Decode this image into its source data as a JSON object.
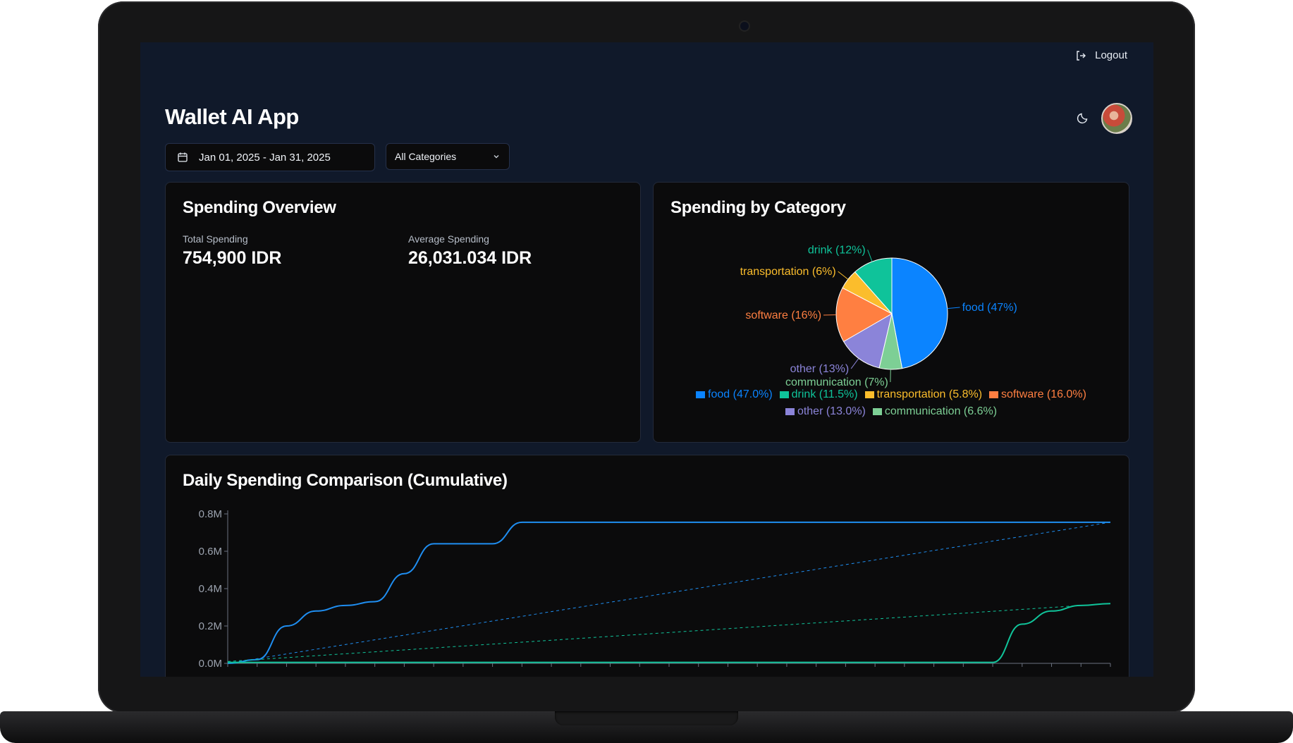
{
  "header": {
    "logout_label": "Logout",
    "app_title": "Wallet AI App"
  },
  "filters": {
    "date_range": "Jan 01, 2025 - Jan 31, 2025",
    "category": "All Categories"
  },
  "overview": {
    "title": "Spending Overview",
    "total_label": "Total Spending",
    "total_value": "754,900 IDR",
    "average_label": "Average Spending",
    "average_value": "26,031.034 IDR"
  },
  "category_card": {
    "title": "Spending by Category"
  },
  "daily_card": {
    "title": "Daily Spending Comparison (Cumulative)"
  },
  "chart_data": [
    {
      "type": "pie",
      "title": "Spending by Category",
      "slices": [
        {
          "name": "food",
          "percent": 47.0,
          "label": "food (47%)",
          "legend": "food (47.0%)",
          "color": "#0b84ff"
        },
        {
          "name": "communication",
          "percent": 6.6,
          "label": "communication (7%)",
          "legend": "communication (6.6%)",
          "color": "#7dcf95"
        },
        {
          "name": "other",
          "percent": 13.0,
          "label": "other (13%)",
          "legend": "other (13.0%)",
          "color": "#8b84d9"
        },
        {
          "name": "software",
          "percent": 16.0,
          "label": "software (16%)",
          "legend": "software (16.0%)",
          "color": "#ff7f41"
        },
        {
          "name": "transportation",
          "percent": 5.8,
          "label": "transportation (6%)",
          "legend": "transportation (5.8%)",
          "color": "#fbbd2c"
        },
        {
          "name": "drink",
          "percent": 11.5,
          "label": "drink (12%)",
          "legend": "drink (11.5%)",
          "color": "#0fc39a"
        }
      ],
      "legend_order": [
        "food",
        "drink",
        "transportation",
        "software",
        "other",
        "communication"
      ]
    },
    {
      "type": "line",
      "title": "Daily Spending Comparison (Cumulative)",
      "y_tick_labels": [
        "0.0M",
        "0.2M",
        "0.4M",
        "0.6M",
        "0.8M"
      ],
      "ylim": [
        0,
        0.8
      ],
      "x_days": 31,
      "series": [
        {
          "color": "#1f8ef1",
          "style": "solid",
          "values": [
            0.0,
            0.02,
            0.2,
            0.28,
            0.31,
            0.33,
            0.48,
            0.64,
            0.64,
            0.64,
            0.755,
            0.755,
            0.755,
            0.755,
            0.755,
            0.755,
            0.755,
            0.755,
            0.755,
            0.755,
            0.755,
            0.755,
            0.755,
            0.755,
            0.755,
            0.755,
            0.755,
            0.755,
            0.755,
            0.755,
            0.755
          ]
        },
        {
          "color": "#1f8ef1",
          "style": "dashed",
          "from": [
            0,
            0
          ],
          "to": [
            31,
            0.755
          ]
        },
        {
          "color": "#10c49a",
          "style": "solid",
          "values": [
            0.005,
            0.005,
            0.005,
            0.005,
            0.005,
            0.005,
            0.005,
            0.005,
            0.005,
            0.005,
            0.005,
            0.005,
            0.005,
            0.005,
            0.005,
            0.005,
            0.005,
            0.005,
            0.005,
            0.005,
            0.005,
            0.005,
            0.005,
            0.005,
            0.005,
            0.005,
            0.005,
            0.21,
            0.28,
            0.31,
            0.32
          ]
        },
        {
          "color": "#10c49a",
          "style": "dashed",
          "from": [
            0,
            0.01
          ],
          "to": [
            31,
            0.32
          ]
        }
      ]
    }
  ]
}
